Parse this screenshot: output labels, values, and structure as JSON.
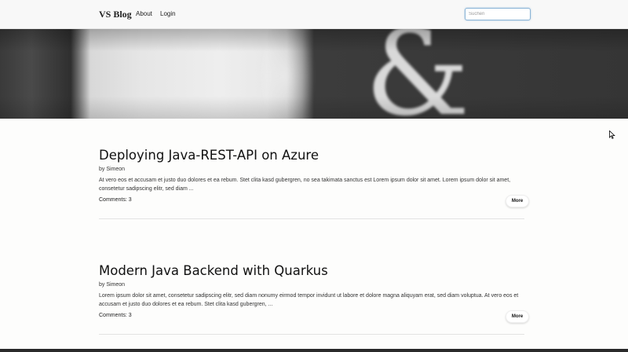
{
  "navbar": {
    "brand": "VS Blog",
    "links": [
      "About",
      "Login"
    ],
    "search_placeholder": "Suchen"
  },
  "posts": [
    {
      "title": "Deploying Java-REST-API on Azure",
      "author": "by Simeon",
      "excerpt": "At vero eos et accusam et justo duo dolores et ea rebum. Stet clita kasd gubergren, no sea takimata sanctus est Lorem ipsum dolor sit amet. Lorem ipsum dolor sit amet, consetetur sadipscing elitr, sed diam ...",
      "comments": "Comments: 3",
      "more_label": "More"
    },
    {
      "title": "Modern Java Backend with Quarkus",
      "author": "by Simeon",
      "excerpt": "Lorem ipsum dolor sit amet, consetetur sadipscing elitr, sed diam nonumy eirmod tempor invidunt ut labore et dolore magna aliquyam erat, sed diam voluptua. At vero eos et accusam et justo duo dolores et ea rebum. Stet clita kasd gubergren, ...",
      "comments": "Comments: 3",
      "more_label": "More"
    }
  ]
}
